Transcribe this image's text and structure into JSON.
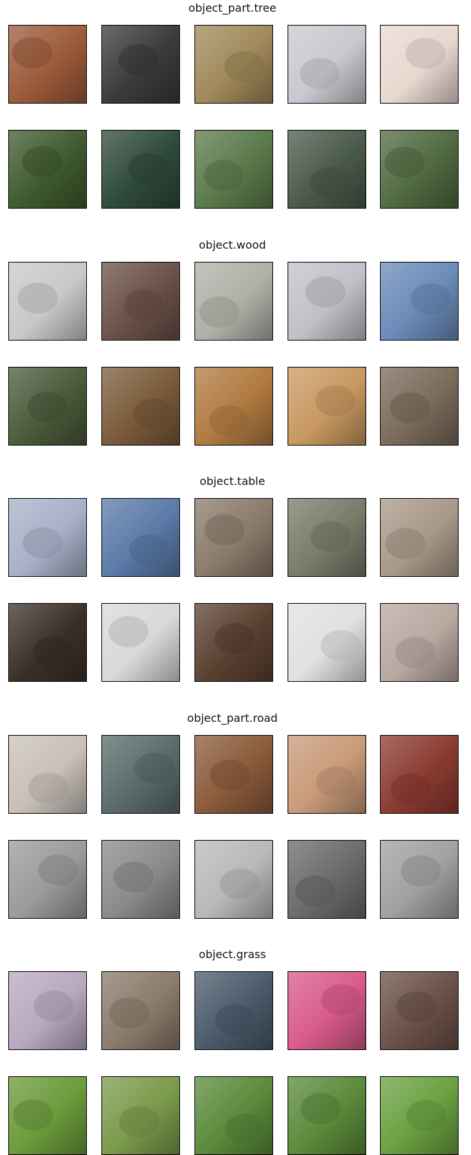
{
  "sections": [
    {
      "title": "object_part.tree",
      "rows": [
        [
          "#9b5a3a",
          "#3a3a3a",
          "#a0885a",
          "#c8c8d0",
          "#e8d8d0"
        ],
        [
          "#3e5a2e",
          "#2e4a3a",
          "#5a7a4a",
          "#4a5a4a",
          "#506a40"
        ]
      ]
    },
    {
      "title": "object.wood",
      "rows": [
        [
          "#c8c8c8",
          "#6a5048",
          "#b0b0a8",
          "#c0c0c8",
          "#6a8ab8"
        ],
        [
          "#4a5a3a",
          "#7a5a3a",
          "#b07a40",
          "#c89860",
          "#7a6a5a"
        ]
      ]
    },
    {
      "title": "object.table",
      "rows": [
        [
          "#a8b0c8",
          "#5a7aa8",
          "#8a7a6a",
          "#7a7a6a",
          "#a89888"
        ],
        [
          "#3a3028",
          "#d8d8d8",
          "#5a4030",
          "#e0e0e0",
          "#b8a8a0"
        ]
      ]
    },
    {
      "title": "object_part.road",
      "rows": [
        [
          "#c8c0b8",
          "#5a6a6a",
          "#8a5a3a",
          "#c89a78",
          "#8a3a30"
        ],
        [
          "#9a9a9a",
          "#8a8a88",
          "#b8b8b8",
          "#6a6a6a",
          "#a0a0a0"
        ]
      ]
    },
    {
      "title": "object.grass",
      "rows": [
        [
          "#b8a8c0",
          "#8a7a6a",
          "#4a5a6a",
          "#d85a8a",
          "#6a5048"
        ],
        [
          "#6a9a3a",
          "#7a9a4a",
          "#5a8a3a",
          "#5a8a3a",
          "#6aa040"
        ]
      ]
    }
  ]
}
